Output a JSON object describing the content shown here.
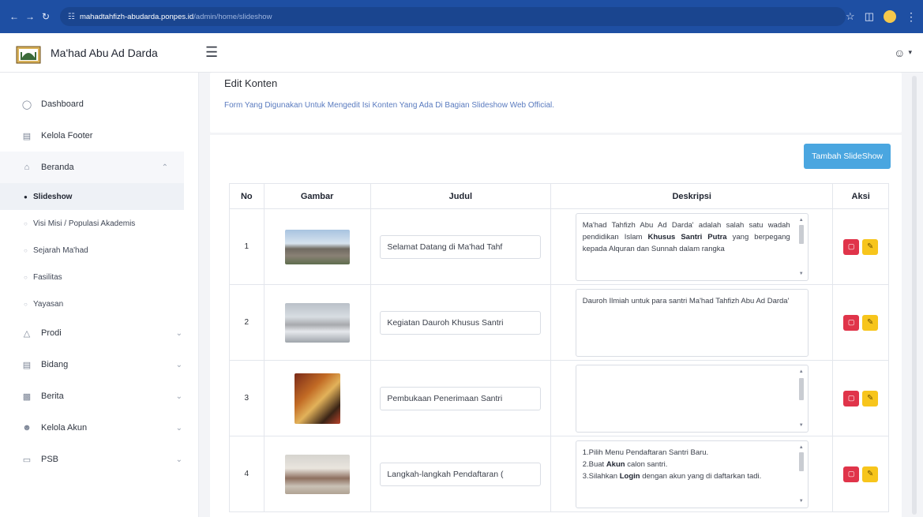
{
  "browser": {
    "url_domain": "mahadtahfizh-abudarda.ponpes.id",
    "url_path": "/admin/home/slideshow"
  },
  "header": {
    "brand_name": "Ma'had Abu Ad Darda"
  },
  "sidebar": {
    "items": [
      {
        "label": "Dashboard",
        "icon": "dashboard-icon"
      },
      {
        "label": "Kelola Footer",
        "icon": "layout-icon"
      },
      {
        "label": "Beranda",
        "icon": "home-icon",
        "expanded": true
      },
      {
        "label": "Prodi",
        "icon": "prodi-icon"
      },
      {
        "label": "Bidang",
        "icon": "table-icon"
      },
      {
        "label": "Berita",
        "icon": "news-icon"
      },
      {
        "label": "Kelola Akun",
        "icon": "users-icon"
      },
      {
        "label": "PSB",
        "icon": "folder-icon"
      }
    ],
    "beranda_sub": [
      {
        "label": "Slideshow",
        "active": true
      },
      {
        "label": "Visi Misi / Populasi Akademis"
      },
      {
        "label": "Sejarah Ma'had"
      },
      {
        "label": "Fasilitas"
      },
      {
        "label": "Yayasan"
      }
    ]
  },
  "main": {
    "title": "Edit Konten",
    "description": "Form Yang Digunakan Untuk Mengedit Isi Konten Yang Ada Di Bagian Slideshow Web Official.",
    "add_button": "Tambah SlideShow",
    "table": {
      "headers": [
        "No",
        "Gambar",
        "Judul",
        "Deskripsi",
        "Aksi"
      ],
      "rows": [
        {
          "no": "1",
          "title": "Selamat Datang di Ma'had Tahf",
          "desc_parts": [
            "Ma'had Tahfizh Abu Ad Darda' adalah salah satu wadah pendidikan Islam ",
            "Khusus Santri Putra",
            " yang berpegang kepada Alquran dan Sunnah dalam rangka"
          ]
        },
        {
          "no": "2",
          "title": "Kegiatan Dauroh Khusus Santri",
          "desc_parts": [
            "Dauroh Ilmiah untuk para santri Ma'had Tahfizh Abu Ad Darda'"
          ]
        },
        {
          "no": "3",
          "title": "Pembukaan Penerimaan Santri",
          "desc_parts": []
        },
        {
          "no": "4",
          "title": "Langkah-langkah Pendaftaran (",
          "desc_lines": [
            "1.Pilih Menu Pendaftaran Santri Baru.",
            "2.Buat ",
            "Akun",
            " calon santri.",
            "3.Silahkan ",
            "Login",
            " dengan akun yang di daftarkan tadi."
          ]
        }
      ]
    }
  },
  "colors": {
    "browser_bar": "#1e4fa3",
    "add_button": "#4aa6e0",
    "delete_button": "#e0344a",
    "edit_button": "#f7c51c",
    "description_text": "#5a7bbf"
  }
}
